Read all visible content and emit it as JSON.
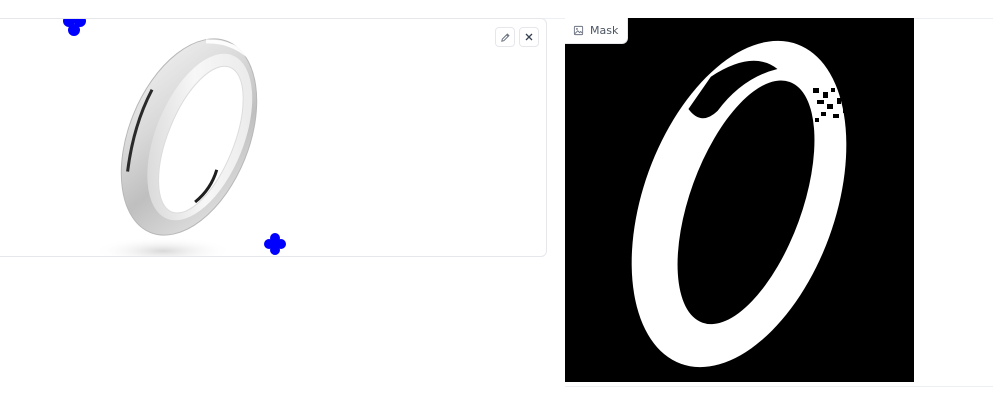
{
  "input_panel": {
    "edit_icon": "pencil-icon",
    "close_icon": "close-icon",
    "points": [
      "point-marker-1",
      "point-marker-2"
    ]
  },
  "output_panel": {
    "label": "Mask",
    "label_icon": "image-icon"
  },
  "colors": {
    "point_marker": "#0000ff",
    "mask_background": "#000000",
    "mask_foreground": "#ffffff",
    "border": "#e5e7eb"
  }
}
